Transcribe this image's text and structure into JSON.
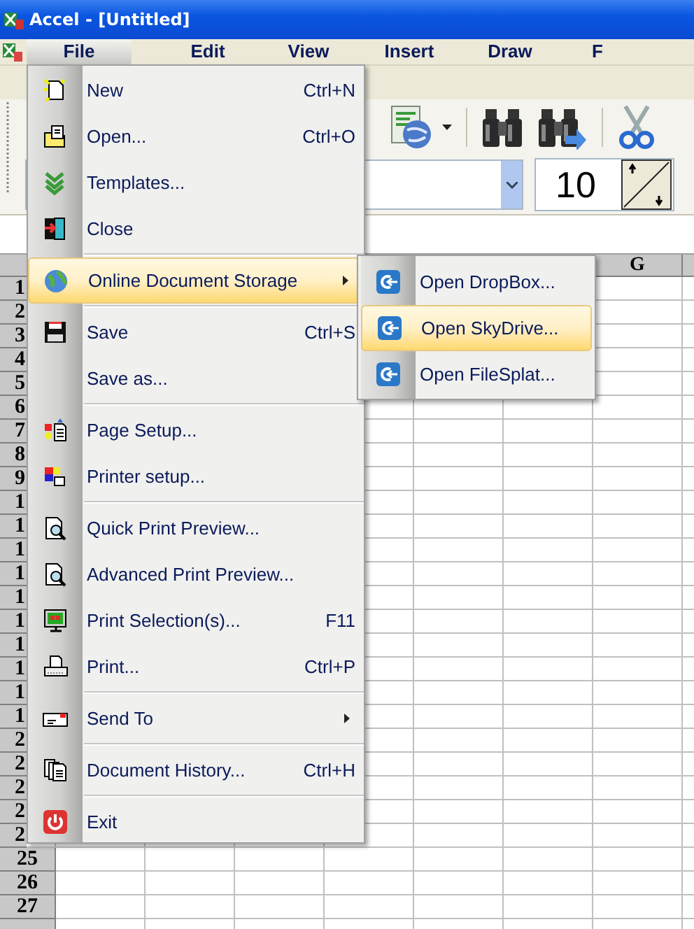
{
  "window": {
    "title": "Accel - [Untitled]"
  },
  "menu_bar": [
    {
      "label": "File",
      "selected": true
    },
    {
      "label": "Edit",
      "selected": false
    },
    {
      "label": "View",
      "selected": false
    },
    {
      "label": "Insert",
      "selected": false
    },
    {
      "label": "Draw",
      "selected": false
    },
    {
      "label": "F",
      "selected": false
    }
  ],
  "toolbar": {
    "font_size": "10"
  },
  "grid": {
    "columns": [
      {
        "label": "G"
      }
    ],
    "rows": [
      {
        "label": "1",
        "covered": true
      },
      {
        "label": "2",
        "covered": true
      },
      {
        "label": "3",
        "covered": true
      },
      {
        "label": "4",
        "covered": true
      },
      {
        "label": "5",
        "covered": true
      },
      {
        "label": "6",
        "covered": true
      },
      {
        "label": "7",
        "covered": true
      },
      {
        "label": "8",
        "covered": true
      },
      {
        "label": "9",
        "covered": true
      },
      {
        "label": "1",
        "covered": true
      },
      {
        "label": "1",
        "covered": true
      },
      {
        "label": "1",
        "covered": true
      },
      {
        "label": "1",
        "covered": true
      },
      {
        "label": "1",
        "covered": true
      },
      {
        "label": "1",
        "covered": true
      },
      {
        "label": "1",
        "covered": true
      },
      {
        "label": "1",
        "covered": true
      },
      {
        "label": "1",
        "covered": true
      },
      {
        "label": "1",
        "covered": true
      },
      {
        "label": "2",
        "covered": true
      },
      {
        "label": "2",
        "covered": true
      },
      {
        "label": "2",
        "covered": true
      },
      {
        "label": "2",
        "covered": true
      },
      {
        "label": "2",
        "covered": true
      },
      {
        "label": "25",
        "covered": false
      },
      {
        "label": "26",
        "covered": false
      },
      {
        "label": "27",
        "covered": false
      },
      {
        "covered": false
      }
    ]
  },
  "file_menu": [
    {
      "kind": "item",
      "label": "New",
      "shortcut": "Ctrl+N",
      "selected": false,
      "submenu": false
    },
    {
      "kind": "item",
      "label": "Open...",
      "shortcut": "Ctrl+O",
      "selected": false,
      "submenu": false
    },
    {
      "kind": "item",
      "label": "Templates...",
      "selected": false,
      "submenu": false
    },
    {
      "kind": "item",
      "label": "Close",
      "selected": false,
      "submenu": false
    },
    {
      "kind": "separator"
    },
    {
      "kind": "item",
      "label": "Online Document Storage",
      "selected": true,
      "submenu": true
    },
    {
      "kind": "separator"
    },
    {
      "kind": "item",
      "label": "Save",
      "shortcut": "Ctrl+S",
      "selected": false,
      "submenu": false
    },
    {
      "kind": "item",
      "label": "Save as...",
      "selected": false,
      "submenu": false
    },
    {
      "kind": "separator"
    },
    {
      "kind": "item",
      "label": "Page Setup...",
      "selected": false,
      "submenu": false
    },
    {
      "kind": "item",
      "label": "Printer setup...",
      "selected": false,
      "submenu": false
    },
    {
      "kind": "separator"
    },
    {
      "kind": "item",
      "label": "Quick Print Preview...",
      "selected": false,
      "submenu": false
    },
    {
      "kind": "item",
      "label": "Advanced Print Preview...",
      "selected": false,
      "submenu": false
    },
    {
      "kind": "item",
      "label": "Print Selection(s)...",
      "shortcut": "F11",
      "selected": false,
      "submenu": false
    },
    {
      "kind": "item",
      "label": "Print...",
      "shortcut": "Ctrl+P",
      "selected": false,
      "submenu": false
    },
    {
      "kind": "separator"
    },
    {
      "kind": "item",
      "label": "Send To",
      "selected": false,
      "submenu": true
    },
    {
      "kind": "separator"
    },
    {
      "kind": "item",
      "label": "Document History...",
      "shortcut": "Ctrl+H",
      "selected": false,
      "submenu": false
    },
    {
      "kind": "separator"
    },
    {
      "kind": "item",
      "label": "Exit",
      "selected": false,
      "submenu": false
    }
  ],
  "storage_submenu": [
    {
      "label": "Open DropBox...",
      "selected": false
    },
    {
      "label": "Open SkyDrive...",
      "selected": true
    },
    {
      "label": "Open FileSplat...",
      "selected": false
    }
  ]
}
